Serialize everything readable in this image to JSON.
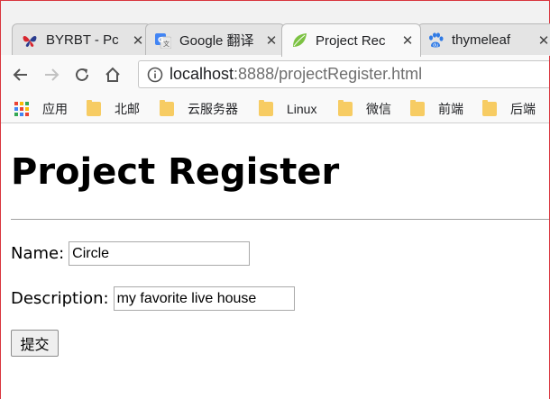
{
  "tabs": [
    {
      "title": "BYRBT - Pc",
      "icon": "butterfly-icon",
      "active": false
    },
    {
      "title": "Google 翻译",
      "icon": "google-translate-icon",
      "active": false
    },
    {
      "title": "Project Rec",
      "icon": "leaf-icon",
      "active": true
    },
    {
      "title": "thymeleaf",
      "icon": "paw-icon",
      "active": false
    }
  ],
  "toolbar": {
    "url_host": "localhost",
    "url_path": ":8888/projectRegister.html"
  },
  "bookmarks": [
    {
      "label": "应用",
      "icon": "apps-grid-icon"
    },
    {
      "label": "北邮",
      "icon": "folder-icon"
    },
    {
      "label": "云服务器",
      "icon": "folder-icon"
    },
    {
      "label": "Linux",
      "icon": "folder-icon"
    },
    {
      "label": "微信",
      "icon": "folder-icon"
    },
    {
      "label": "前端",
      "icon": "folder-icon"
    },
    {
      "label": "后端",
      "icon": "folder-icon"
    }
  ],
  "page": {
    "heading": "Project Register",
    "name_label": "Name:",
    "name_value": "Circle",
    "description_label": "Description:",
    "description_value": "my favorite live house",
    "submit_label": "提交"
  },
  "colors": {
    "folder": "#f7cc63",
    "window_edge": "#d9363e",
    "leaf": "#7cc243",
    "baidu_blue": "#2f7ae5"
  }
}
